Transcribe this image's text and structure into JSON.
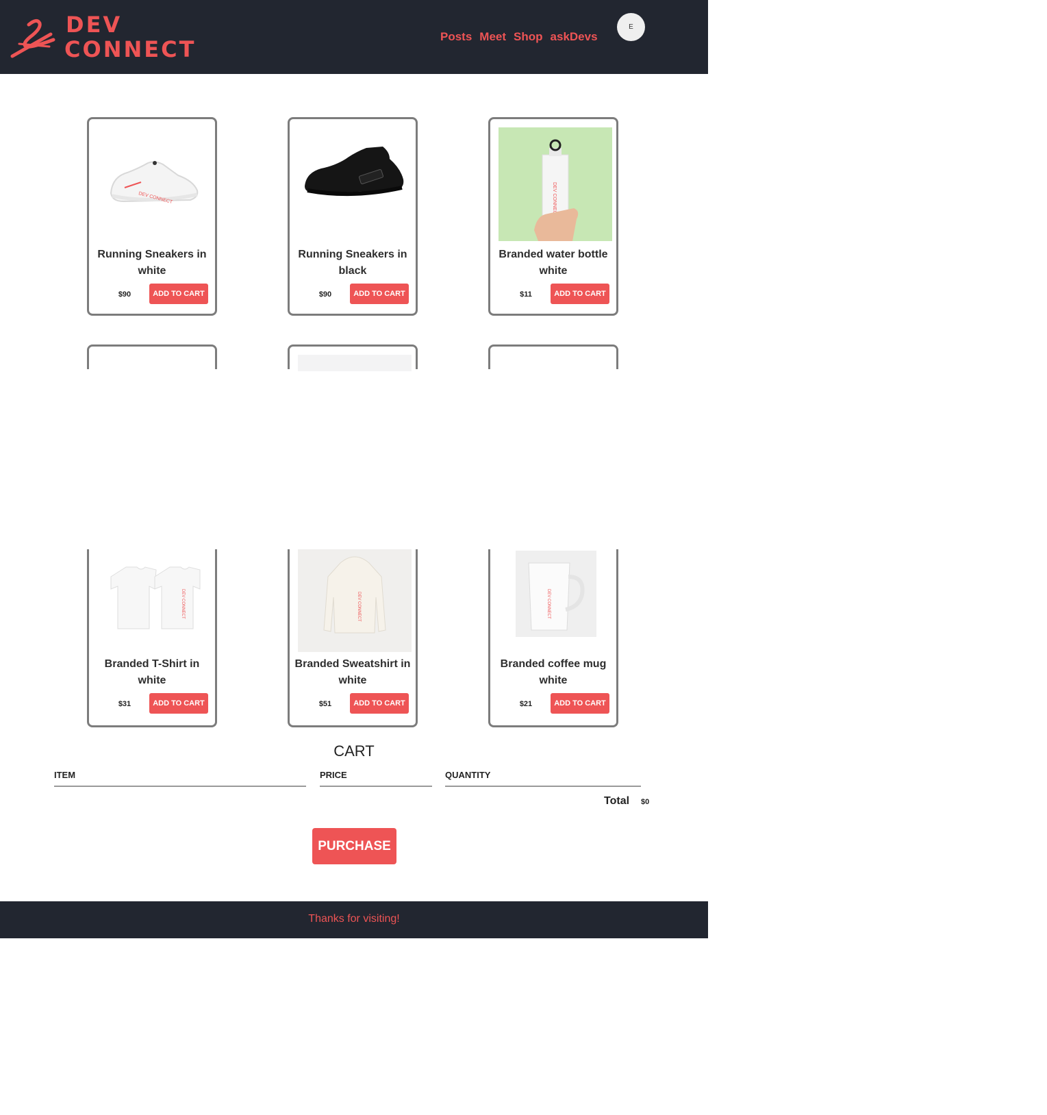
{
  "brand": {
    "line1": "DEV",
    "line2": "CONNECT",
    "color": "#ee5455"
  },
  "nav": {
    "items": [
      {
        "label": "Posts"
      },
      {
        "label": "Meet"
      },
      {
        "label": "Shop"
      },
      {
        "label": "askDevs"
      }
    ]
  },
  "user": {
    "avatar_initial": "E"
  },
  "products": [
    {
      "title": "Running Sneakers in white",
      "price": "$90",
      "button": "ADD TO CART",
      "image_icon": "white-sneaker-image"
    },
    {
      "title": "Running Sneakers in black",
      "price": "$90",
      "button": "ADD TO CART",
      "image_icon": "black-sneaker-image"
    },
    {
      "title": "Branded water bottle white",
      "price": "$11",
      "button": "ADD TO CART",
      "image_icon": "water-bottle-image"
    },
    {
      "title": "Branded T-Shirt in white",
      "price": "$31",
      "button": "ADD TO CART",
      "image_icon": "tshirt-image"
    },
    {
      "title": "Branded Sweatshirt in white",
      "price": "$51",
      "button": "ADD TO CART",
      "image_icon": "sweatshirt-image"
    },
    {
      "title": "Branded coffee mug white",
      "price": "$21",
      "button": "ADD TO CART",
      "image_icon": "coffee-mug-image"
    }
  ],
  "cart": {
    "title": "CART",
    "columns": [
      "ITEM",
      "PRICE",
      "QUANTITY"
    ],
    "total_label": "Total",
    "total_value": "$0",
    "purchase_label": "PURCHASE"
  },
  "footer": {
    "text": "Thanks for visiting!"
  },
  "colors": {
    "header_bg": "#222630",
    "accent": "#ee5455"
  }
}
